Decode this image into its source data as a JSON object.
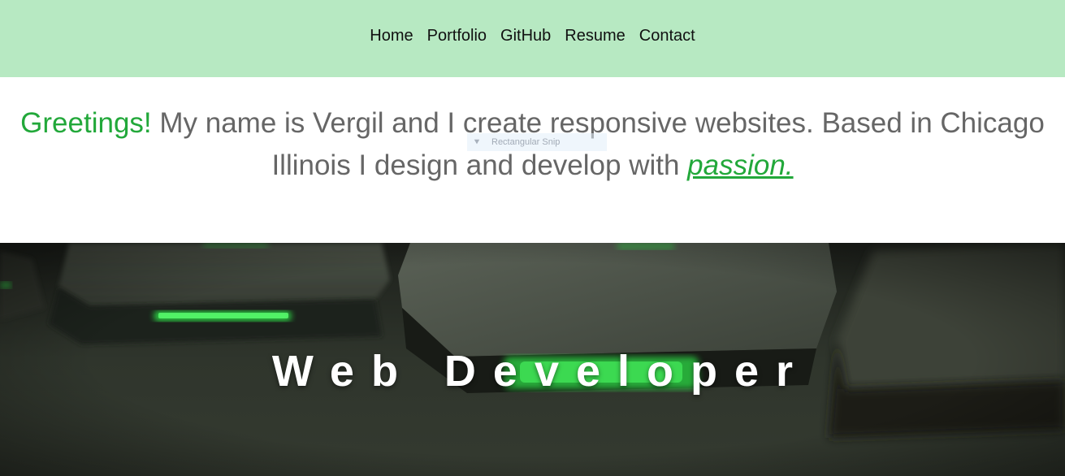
{
  "nav": {
    "items": [
      {
        "label": "Home"
      },
      {
        "label": "Portfolio"
      },
      {
        "label": "GitHub"
      },
      {
        "label": "Resume"
      },
      {
        "label": "Contact"
      }
    ]
  },
  "intro": {
    "greeting": "Greetings!",
    "body": " My name is Vergil and I create responsive websites. Based in Chicago Illinois I design and develop with ",
    "passion_link": "passion."
  },
  "snip_overlay": {
    "label": "Rectangular Snip",
    "icon": "scissors-icon"
  },
  "hero": {
    "title": "Web Developer",
    "icon": "keyboard-photo"
  },
  "colors": {
    "nav_bg": "#b7e9c2",
    "accent_green": "#22a83a",
    "body_text": "#666666",
    "hero_text": "#ffffff",
    "key_glow": "#2ee84a"
  }
}
